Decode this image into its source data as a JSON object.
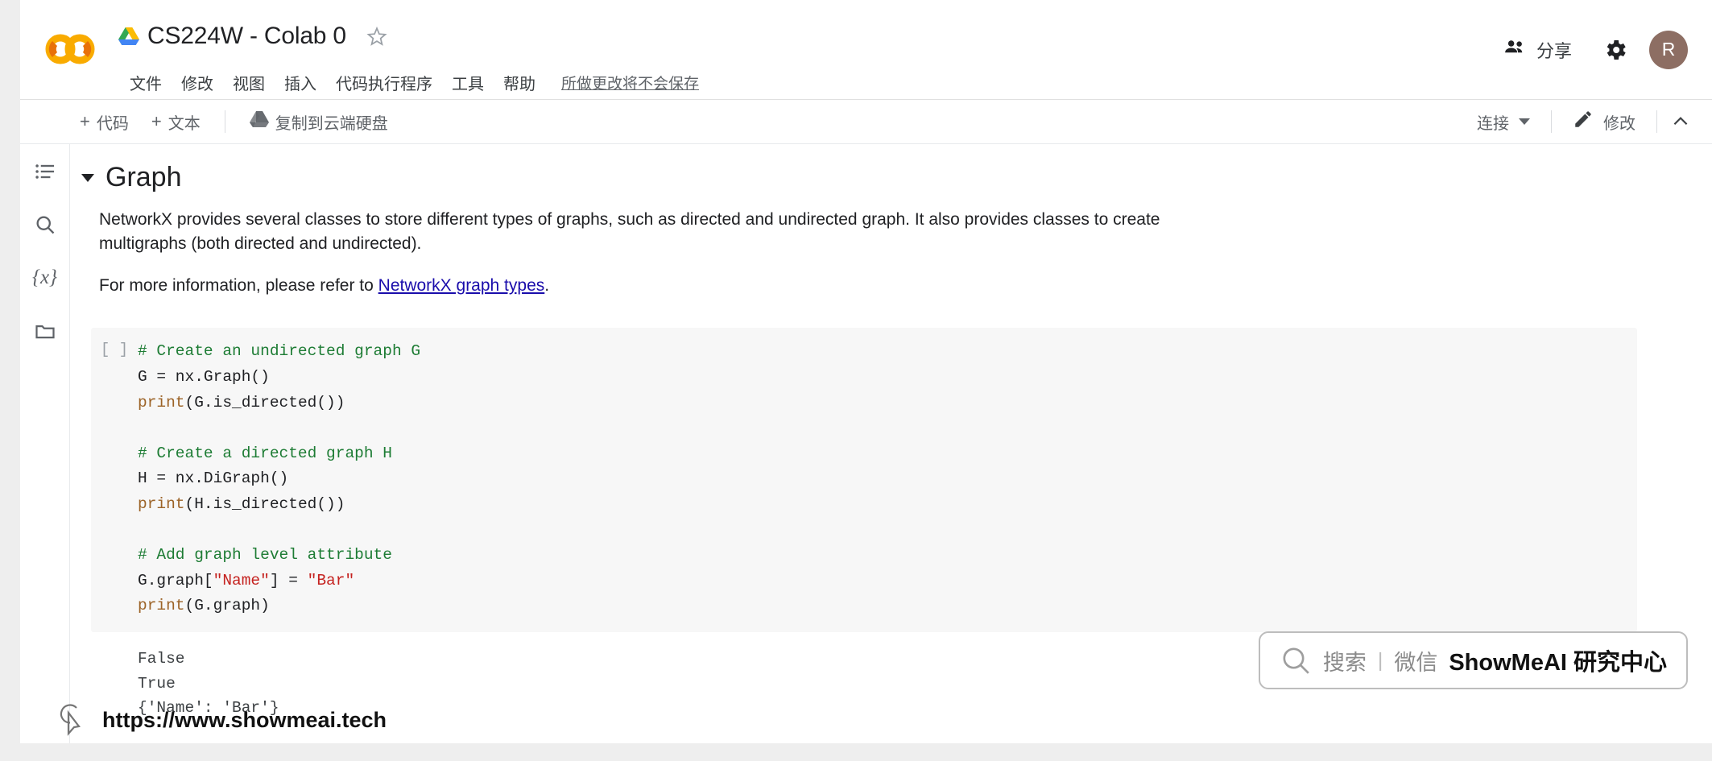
{
  "app": {
    "logo": "colab-logo",
    "doc_title": "CS224W - Colab 0",
    "drive_icon": "drive-icon",
    "star_icon": "star-icon"
  },
  "menubar": {
    "items": [
      {
        "label": "文件",
        "name": "file"
      },
      {
        "label": "修改",
        "name": "edit"
      },
      {
        "label": "视图",
        "name": "view"
      },
      {
        "label": "插入",
        "name": "insert"
      },
      {
        "label": "代码执行程序",
        "name": "runtime"
      },
      {
        "label": "工具",
        "name": "tools"
      },
      {
        "label": "帮助",
        "name": "help"
      }
    ],
    "save_note": "所做更改将不会保存"
  },
  "header_right": {
    "share_label": "分享",
    "share_icon": "people-icon",
    "settings_icon": "gear-icon",
    "avatar_initial": "R",
    "avatar_color": "#8d6e63"
  },
  "toolbar": {
    "add_code_label": "代码",
    "add_text_label": "文本",
    "plus": "+",
    "copy_to_drive_label": "复制到云端硬盘",
    "copy_to_drive_icon": "drive-icon",
    "connect_label": "连接",
    "edit_label": "修改",
    "edit_icon": "pencil-icon",
    "collapse_icon": "chevron-up-icon"
  },
  "rail": {
    "items": [
      {
        "name": "table-of-contents-icon"
      },
      {
        "name": "search-icon"
      },
      {
        "name": "variables-icon",
        "label": "{x}"
      },
      {
        "name": "files-icon"
      }
    ]
  },
  "content": {
    "heading": "Graph",
    "paragraph1": "NetworkX provides several classes to store different types of graphs, such as directed and undirected graph. It also provides classes to create multigraphs (both directed and undirected).",
    "paragraph2_before": "For more information, please refer to ",
    "paragraph2_link": "NetworkX graph types",
    "paragraph2_after": ".",
    "cell": {
      "run_marker": "[ ]",
      "code_lines": [
        {
          "t": "comment",
          "text": "# Create an undirected graph G"
        },
        {
          "t": "mixed",
          "text": "G = nx.Graph()"
        },
        {
          "t": "call",
          "text": "print(G.is_directed())"
        },
        {
          "t": "blank",
          "text": ""
        },
        {
          "t": "comment",
          "text": "# Create a directed graph H"
        },
        {
          "t": "mixed",
          "text": "H = nx.DiGraph()"
        },
        {
          "t": "call",
          "text": "print(H.is_directed())"
        },
        {
          "t": "blank",
          "text": ""
        },
        {
          "t": "comment",
          "text": "# Add graph level attribute"
        },
        {
          "t": "string",
          "text": "G.graph[\"Name\"] = \"Bar\""
        },
        {
          "t": "call",
          "text": "print(G.graph)"
        }
      ],
      "output": "False\nTrue\n{'Name': 'Bar'}"
    }
  },
  "watermark": {
    "search_icon": "search-icon",
    "gray_text": "搜索",
    "divider": "|",
    "gray_text2": "微信",
    "bold_text": "ShowMeAI 研究中心"
  },
  "footer": {
    "cursor_icon": "cursor-arrow-icon",
    "url": "https://www.showmeai.tech"
  }
}
